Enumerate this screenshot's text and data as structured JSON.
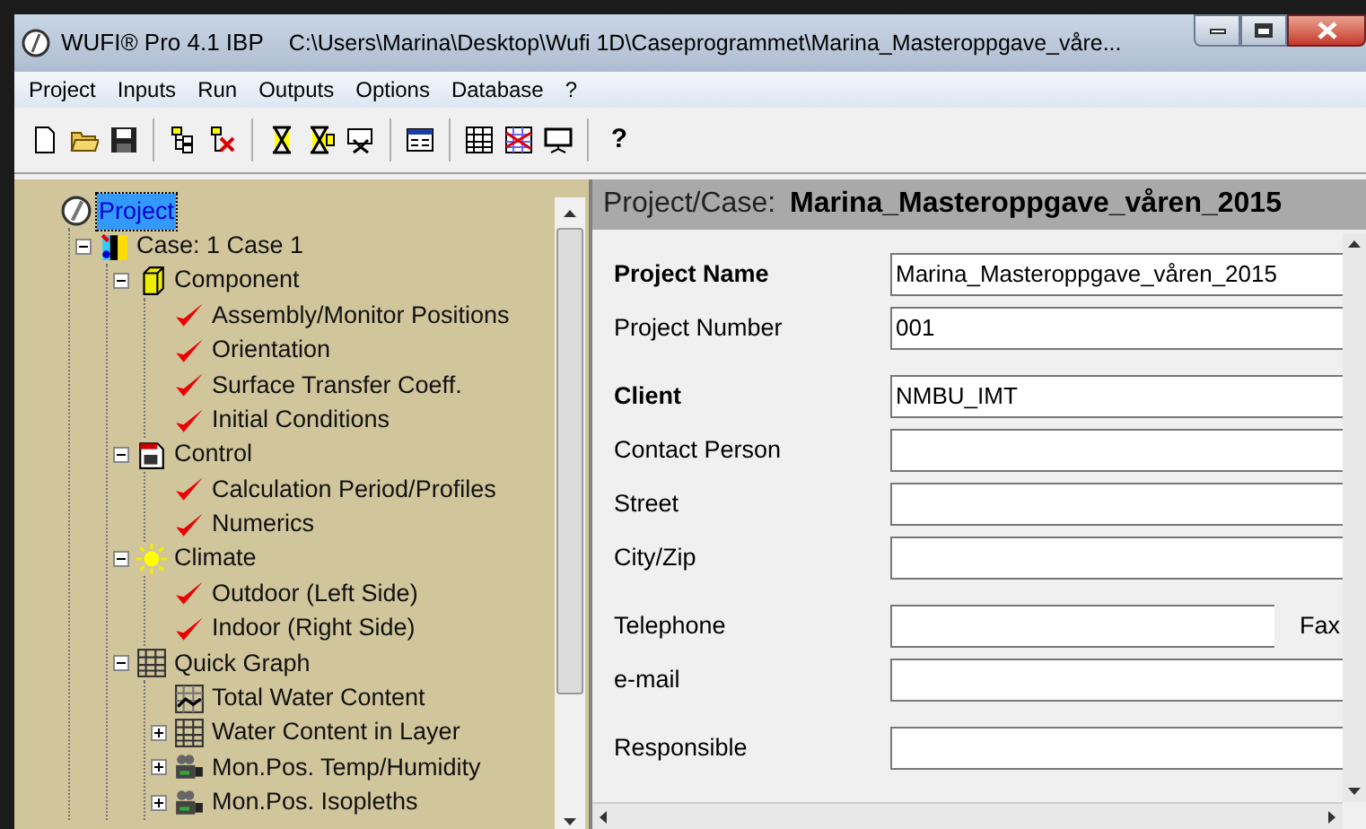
{
  "window": {
    "title": "WUFI® Pro 4.1 IBP",
    "path": "C:\\Users\\Marina\\Desktop\\Wufi 1D\\Caseprogrammet\\Marina_Masteroppgave_våre..."
  },
  "menu": [
    "Project",
    "Inputs",
    "Run",
    "Outputs",
    "Options",
    "Database",
    "?"
  ],
  "toolbar": [
    {
      "kind": "new"
    },
    {
      "kind": "open"
    },
    {
      "kind": "save"
    },
    {
      "kind": "sep"
    },
    {
      "kind": "tree"
    },
    {
      "kind": "tree-x"
    },
    {
      "kind": "sep"
    },
    {
      "kind": "hourglass"
    },
    {
      "kind": "hourglass2"
    },
    {
      "kind": "hourglass3"
    },
    {
      "kind": "sep"
    },
    {
      "kind": "window"
    },
    {
      "kind": "sep"
    },
    {
      "kind": "grid"
    },
    {
      "kind": "grid-red"
    },
    {
      "kind": "screen"
    },
    {
      "kind": "sep"
    },
    {
      "kind": "help",
      "label": "?"
    }
  ],
  "tree": [
    {
      "label": "Project",
      "kind": "project",
      "selected": true,
      "children": [
        {
          "label": "Case: 1 Case 1",
          "kind": "case",
          "selected": false,
          "expanded": true,
          "children": [
            {
              "label": "Component",
              "kind": "component",
              "selected": false,
              "expanded": true,
              "children": [
                {
                  "label": "Assembly/Monitor Positions",
                  "kind": "check",
                  "selected": false
                },
                {
                  "label": "Orientation",
                  "kind": "check",
                  "selected": false
                },
                {
                  "label": "Surface Transfer Coeff.",
                  "kind": "check",
                  "selected": false
                },
                {
                  "label": "Initial Conditions",
                  "kind": "check",
                  "selected": false
                }
              ]
            },
            {
              "label": "Control",
              "kind": "calendar",
              "selected": false,
              "expanded": true,
              "children": [
                {
                  "label": "Calculation Period/Profiles",
                  "kind": "check",
                  "selected": false
                },
                {
                  "label": "Numerics",
                  "kind": "check",
                  "selected": false
                }
              ]
            },
            {
              "label": "Climate",
              "kind": "sun",
              "selected": false,
              "expanded": true,
              "children": [
                {
                  "label": "Outdoor (Left Side)",
                  "kind": "check",
                  "selected": false
                },
                {
                  "label": "Indoor (Right Side)",
                  "kind": "check",
                  "selected": false
                }
              ]
            },
            {
              "label": "Quick Graph",
              "kind": "grid",
              "selected": false,
              "expanded": true,
              "children": [
                {
                  "label": "Total Water Content",
                  "kind": "chart",
                  "selected": false
                },
                {
                  "label": "Water Content in Layer",
                  "kind": "grid",
                  "selected": false,
                  "expanded": false
                },
                {
                  "label": "Mon.Pos. Temp/Humidity",
                  "kind": "camera",
                  "selected": false,
                  "expanded": false
                },
                {
                  "label": "Mon.Pos. Isopleths",
                  "kind": "camera",
                  "selected": false,
                  "expanded": false
                }
              ]
            }
          ]
        }
      ]
    }
  ],
  "header": {
    "label": "Project/Case:",
    "value": "Marina_Masteroppgave_våren_2015"
  },
  "field_groups": [
    [
      {
        "label": "Project Name",
        "bold": true,
        "value": "Marina_Masteroppgave_våren_2015"
      },
      {
        "label": "Project Number",
        "bold": false,
        "value": "001"
      }
    ],
    [
      {
        "label": "Client",
        "bold": true,
        "value": "NMBU_IMT"
      },
      {
        "label": "Contact Person",
        "bold": false
      },
      {
        "label": "Street",
        "bold": false
      },
      {
        "label": "City/Zip",
        "bold": false
      }
    ],
    [
      {
        "label": "Telephone",
        "bold": false,
        "side_label": "Fax"
      },
      {
        "label": "e-mail",
        "bold": false
      }
    ],
    [
      {
        "label": "Responsible",
        "bold": false
      }
    ]
  ]
}
